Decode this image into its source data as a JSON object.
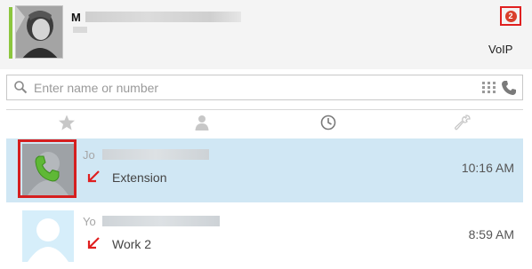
{
  "header": {
    "profile_name_initial": "M",
    "notification_count": "2",
    "account_label": "VoIP",
    "status_color": "#8cc63e"
  },
  "search": {
    "placeholder": "Enter name or number",
    "value": "",
    "icons": [
      "search-icon",
      "dialpad-icon",
      "phone-icon"
    ]
  },
  "tabs": [
    {
      "name": "favorites",
      "icon": "star-icon"
    },
    {
      "name": "contacts",
      "icon": "person-icon"
    },
    {
      "name": "history",
      "icon": "clock-icon",
      "active": true
    },
    {
      "name": "settings",
      "icon": "wrench-icon"
    }
  ],
  "calls": [
    {
      "name_fragment": "Jo",
      "type": "Extension",
      "time": "10:16 AM",
      "selected": true,
      "avatar_icon": "phone-call-avatar-icon",
      "direction_icon": "missed-call-arrow-icon"
    },
    {
      "name_fragment": "Yo",
      "type": "Work 2",
      "time": "8:59 AM",
      "selected": false,
      "avatar_icon": "default-person-avatar-icon",
      "direction_icon": "missed-call-arrow-icon"
    }
  ],
  "colors": {
    "accent_selected": "#d0e7f4",
    "badge_red": "#d93f2b",
    "highlight_red": "#d61f1f",
    "missed_arrow_red": "#e01f1f",
    "call_green": "#5fb836"
  }
}
